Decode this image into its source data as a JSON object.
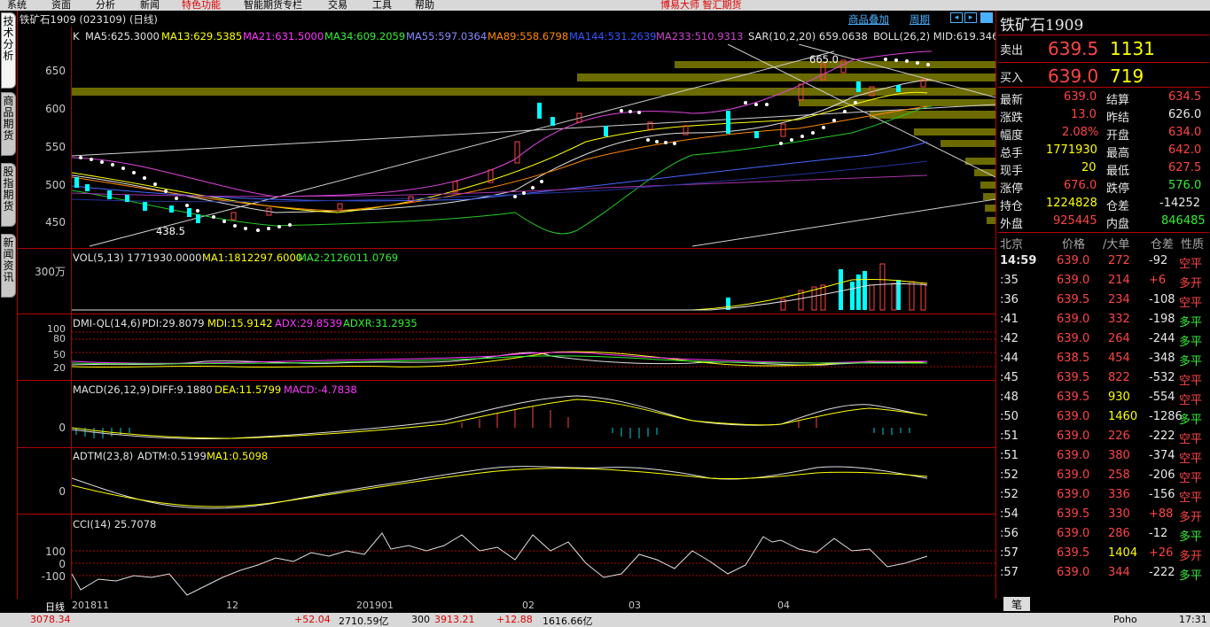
{
  "menu": {
    "items": [
      "系统",
      "资面",
      "分析",
      "新闻",
      "特色功能",
      "智能期货专栏",
      "交易",
      "工具",
      "帮助"
    ],
    "promo": "博易大师 智汇期货"
  },
  "left_tabs": [
    "技术分析",
    "商品期货",
    "股指期货",
    "新闻资讯"
  ],
  "chart": {
    "header": "铁矿石1909 (023109) (日线)",
    "links": [
      "商品叠加",
      "周期"
    ],
    "ma_line": {
      "k": "K",
      "ma5": "MA5:625.3000",
      "ma13": "MA13:629.5385",
      "ma21": "MA21:631.5000",
      "ma34": "MA34:609.2059",
      "ma55": "MA55:597.0364",
      "ma89": "MA89:558.6798",
      "ma144": "MA144:531.2639",
      "ma233": "MA233:510.9313",
      "sar": "SAR(10,2,20)  659.0638",
      "boll": "BOLL(26,2)  MID:619.346"
    },
    "price_labels": [
      "650",
      "600",
      "550",
      "500",
      "450"
    ],
    "high_label": "665.0",
    "low_label": "438.5",
    "vol": {
      "title": "VOL(5,13)  1771930.0000",
      "ma1": "MA1:1812297.6000",
      "ma2": "MA2:2126011.0769",
      "scale": "300万"
    },
    "dmi": {
      "title": "DMI-QL(14,6)",
      "pdi": "PDI:29.8079",
      "mdi": "MDI:15.9142",
      "adx": "ADX:29.8539",
      "adxr": "ADXR:31.2935",
      "scale": [
        "100",
        "80",
        "50",
        "20"
      ]
    },
    "macd": {
      "title": "MACD(26,12,9)",
      "diff": "DIFF:9.1880",
      "dea": "DEA:11.5799",
      "macd": "MACD:-4.7838",
      "zero": "0"
    },
    "adtm": {
      "title": "ADTM(23,8)",
      "adtm": "ADTM:0.5199",
      "ma1": "MA1:0.5098",
      "zero": "0"
    },
    "cci": {
      "title": "CCI(14)  25.7078",
      "scale": [
        "100",
        "0",
        "-100"
      ]
    },
    "date_axis": {
      "period": "日线",
      "dates": [
        "201811",
        "12",
        "201901",
        "02",
        "03",
        "04"
      ]
    }
  },
  "quote": {
    "name": "铁矿石1909",
    "sell": {
      "label": "卖出",
      "price": "639.5",
      "vol": "1131"
    },
    "buy": {
      "label": "买入",
      "price": "639.0",
      "vol": "719"
    },
    "rows": [
      [
        "最新",
        "639.0",
        "结算",
        "634.5"
      ],
      [
        "涨跌",
        "13.0",
        "昨结",
        "626.0"
      ],
      [
        "幅度",
        "2.08%",
        "开盘",
        "634.0"
      ],
      [
        "总手",
        "1771930",
        "最高",
        "642.0"
      ],
      [
        "现手",
        "20",
        "最低",
        "627.5"
      ],
      [
        "涨停",
        "676.0",
        "跌停",
        "576.0"
      ],
      [
        "持仓",
        "1224828",
        "仓差",
        "-14252"
      ],
      [
        "外盘",
        "925445",
        "内盘",
        "846485"
      ]
    ],
    "ticks_header": [
      "北京",
      "价格",
      "/大单",
      "仓差",
      "性质"
    ],
    "ticks": [
      [
        "14:59",
        "639.0",
        "272",
        "-92",
        "空平"
      ],
      [
        ":35",
        "639.0",
        "214",
        "+6",
        "多开"
      ],
      [
        ":36",
        "639.5",
        "234",
        "-108",
        "空平"
      ],
      [
        ":41",
        "639.0",
        "332",
        "-198",
        "多平"
      ],
      [
        ":42",
        "639.0",
        "264",
        "-244",
        "多平"
      ],
      [
        ":44",
        "638.5",
        "454",
        "-348",
        "多平"
      ],
      [
        ":45",
        "639.5",
        "822",
        "-532",
        "空平"
      ],
      [
        ":48",
        "639.5",
        "930",
        "-554",
        "空平"
      ],
      [
        ":50",
        "639.0",
        "1460",
        "-1286",
        "多平"
      ],
      [
        ":51",
        "639.0",
        "226",
        "-222",
        "空平"
      ],
      [
        ":51",
        "639.0",
        "380",
        "-374",
        "空平"
      ],
      [
        ":52",
        "639.0",
        "258",
        "-206",
        "空平"
      ],
      [
        ":52",
        "639.0",
        "336",
        "-156",
        "空平"
      ],
      [
        ":54",
        "639.5",
        "330",
        "+88",
        "多开"
      ],
      [
        ":56",
        "639.0",
        "286",
        "-12",
        "多平"
      ],
      [
        ":57",
        "639.5",
        "1404",
        "+26",
        "多开"
      ],
      [
        ":57",
        "639.0",
        "344",
        "-222",
        "多平"
      ]
    ],
    "bottom_tab": "笔"
  },
  "status": {
    "items": [
      "3078.34",
      "+52.04",
      "2710.59亿",
      "300",
      "3913.21",
      "+12.88",
      "1616.66亿"
    ],
    "right": [
      "Poho",
      "17:31"
    ]
  }
}
